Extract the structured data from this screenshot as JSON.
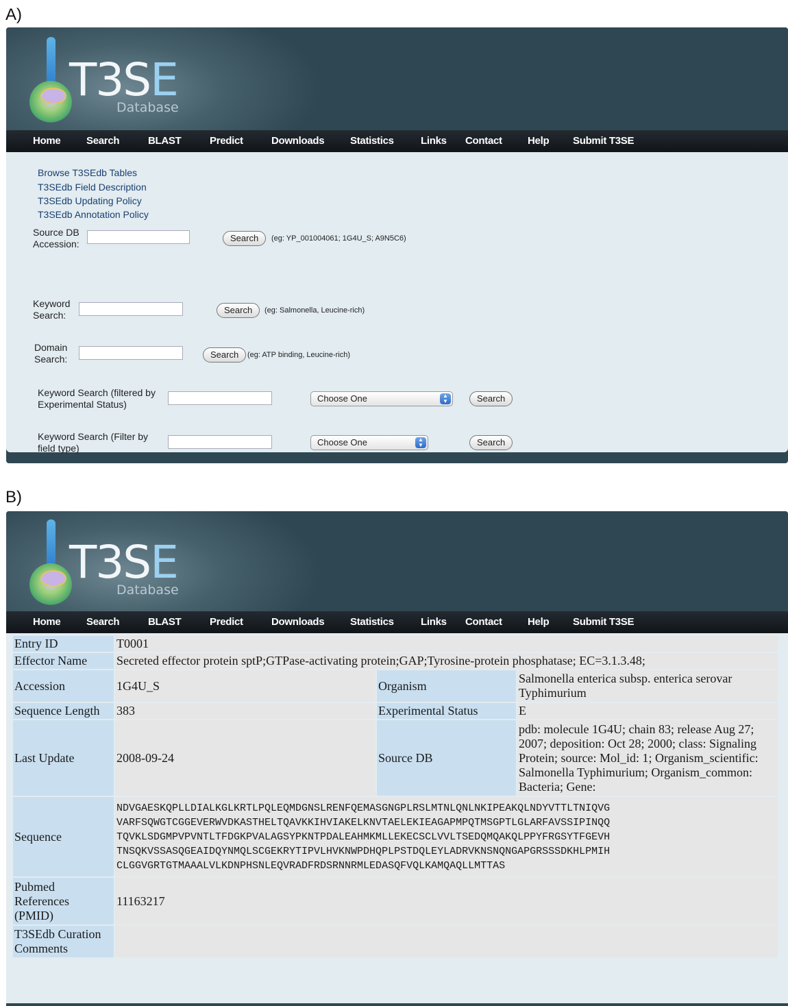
{
  "panel_a": {
    "label": "A)",
    "logo": {
      "brand": "T3SE",
      "subtitle": "Database"
    },
    "nav": [
      "Home",
      "Search",
      "BLAST",
      "Predict",
      "Downloads",
      "Statistics",
      "Links",
      "Contact",
      "Help",
      "Submit T3SE"
    ],
    "links": [
      "Browse T3SEdb Tables",
      "T3SEdb Field Description",
      "T3SEdb Updating Policy",
      "T3SEdb Annotation Policy"
    ],
    "forms": [
      {
        "label_line1": "Source DB",
        "label_line2": "Accession:",
        "button": "Search",
        "hint": "(eg: YP_001004061; 1G4U_S; A9N5C6)"
      },
      {
        "label_line1": "Keyword",
        "label_line2": "Search:",
        "button": "Search",
        "hint": "(eg: Salmonella, Leucine-rich)"
      },
      {
        "label_line1": "Domain",
        "label_line2": "Search:",
        "button": "Search",
        "hint": "(eg: ATP binding, Leucine-rich)"
      },
      {
        "label_line1": "Keyword Search (filtered by",
        "label_line2": "Experimental Status)",
        "select": "Choose One",
        "button": "Search"
      },
      {
        "label_line1": "Keyword Search (Filter by",
        "label_line2": "field type)",
        "select": "Choose One",
        "button": "Search"
      }
    ]
  },
  "panel_b": {
    "label": "B)",
    "logo": {
      "brand": "T3SE",
      "subtitle": "Database"
    },
    "nav": [
      "Home",
      "Search",
      "BLAST",
      "Predict",
      "Downloads",
      "Statistics",
      "Links",
      "Contact",
      "Help",
      "Submit T3SE"
    ],
    "entry": {
      "entry_id_label": "Entry ID",
      "entry_id": "T0001",
      "effector_name_label": "Effector Name",
      "effector_name": "Secreted effector protein sptP;GTPase-activating protein;GAP;Tyrosine-protein phosphatase; EC=3.1.3.48;",
      "accession_label": "Accession",
      "accession": "1G4U_S",
      "organism_label": "Organism",
      "organism_line1": "Salmonella enterica subsp. enterica serovar",
      "organism_line2": "Typhimurium",
      "seq_length_label": "Sequence Length",
      "seq_length": "383",
      "exp_status_label": "Experimental Status",
      "exp_status": "E",
      "last_update_label": "Last Update",
      "last_update": "2008-09-24",
      "source_db_label": "Source DB",
      "source_db_lines": [
        "pdb: molecule 1G4U; chain 83; release Aug 27;",
        "2007; deposition: Oct 28; 2000; class: Signaling",
        "Protein; source: Mol_id: 1; Organism_scientific:",
        "Salmonella Typhimurium; Organism_common:",
        "Bacteria; Gene:"
      ],
      "sequence_label": "Sequence",
      "sequence_lines": [
        "NDVGAESKQPLLDIALKGLKRTLPQLEQMDGNSLRENFQEMASGNGPLRSLMTNLQNLNKIPEAKQLNDYVTTLTNIQVG",
        "VARFSQWGTCGGEVERWVDKASTHELTQAVKKIHVIAKELKNVTAELEKIEAGAPMPQTMSGPTLGLARFAVSSIPINQQ",
        "TQVKLSDGMPVPVNTLTFDGKPVALAGSYPKNTPDALEAHMKMLLEKECSCLVVLTSEDQMQAKQLPPYFRGSYTFGEVH",
        "TNSQKVSSASQGEAIDQYNMQLSCGEKRYTIPVLHVKNWPDHQPLPSTDQLEYLADRVKNSNQNGAPGRSSSDKHLPMIH",
        "CLGGVGRTGTMAAALVLKDNPHSNLEQVRADFRDSRNNRMLEDASQFVQLKAMQAQLLMTTAS"
      ],
      "pubmed_label_lines": [
        "Pubmed",
        "References",
        "(PMID)"
      ],
      "pubmed": "11163217",
      "curation_label_lines": [
        "T3SEdb Curation",
        "Comments"
      ],
      "curation": ""
    }
  }
}
